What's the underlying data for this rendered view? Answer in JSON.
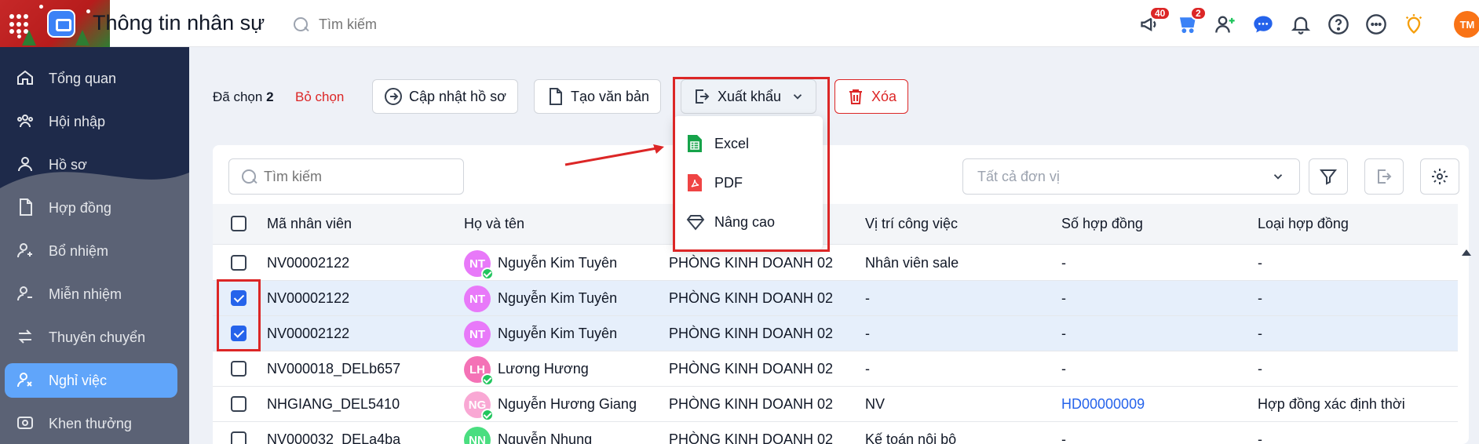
{
  "header": {
    "title": "Thông tin nhân sự",
    "search_placeholder": "Tìm kiếm",
    "badges": {
      "announce": "40",
      "cart": "2"
    },
    "avatar": "TM"
  },
  "sidebar": {
    "items": [
      {
        "label": "Tổng quan",
        "icon": "home-icon"
      },
      {
        "label": "Hội nhập",
        "icon": "group-icon"
      },
      {
        "label": "Hồ sơ",
        "icon": "user-icon"
      },
      {
        "label": "Hợp đồng",
        "icon": "document-icon"
      },
      {
        "label": "Bổ nhiệm",
        "icon": "user-plus-icon"
      },
      {
        "label": "Miễn nhiệm",
        "icon": "user-minus-icon"
      },
      {
        "label": "Thuyên chuyển",
        "icon": "transfer-icon"
      },
      {
        "label": "Nghỉ việc",
        "icon": "user-x-icon",
        "active": true
      },
      {
        "label": "Khen thưởng",
        "icon": "award-icon"
      }
    ]
  },
  "actions": {
    "selected_prefix": "Đã chọn",
    "selected_count": "2",
    "deselect": "Bỏ chọn",
    "update_profile": "Cập nhật hồ sơ",
    "create_doc": "Tạo văn bản",
    "export": "Xuất khẩu",
    "delete": "Xóa"
  },
  "export_menu": {
    "items": [
      "Excel",
      "PDF",
      "Nâng cao"
    ]
  },
  "filters": {
    "search_placeholder": "Tìm kiếm",
    "unit_select": "Tất cả đơn vị"
  },
  "table": {
    "columns": [
      "Mã nhân viên",
      "Họ và tên",
      "Vị trí công việc",
      "Số hợp đồng",
      "Loại hợp đồng"
    ],
    "rows": [
      {
        "code": "NV00002122",
        "initials": "NT",
        "name": "Nguyễn Kim Tuyên",
        "dept": "PHÒNG KINH DOANH 02",
        "position": "Nhân viên sale",
        "contract_no": "-",
        "contract_type": "-",
        "checked": false,
        "color": "#e879f9"
      },
      {
        "code": "NV00002122",
        "initials": "NT",
        "name": "Nguyễn Kim Tuyên",
        "dept": "PHÒNG KINH DOANH 02",
        "position": "-",
        "contract_no": "-",
        "contract_type": "-",
        "checked": true,
        "color": "#e879f9"
      },
      {
        "code": "NV00002122",
        "initials": "NT",
        "name": "Nguyễn Kim Tuyên",
        "dept": "PHÒNG KINH DOANH 02",
        "position": "-",
        "contract_no": "-",
        "contract_type": "-",
        "checked": true,
        "color": "#e879f9"
      },
      {
        "code": "NV000018_DELb657",
        "initials": "LH",
        "name": "Lương Hương",
        "dept": "PHÒNG KINH DOANH 02",
        "position": "-",
        "contract_no": "-",
        "contract_type": "-",
        "checked": false,
        "color": "#f472b6"
      },
      {
        "code": "NHGIANG_DEL5410",
        "initials": "NG",
        "name": "Nguyễn Hương Giang",
        "dept": "PHÒNG KINH DOANH 02",
        "position": "NV",
        "contract_no": "HD00000009",
        "contract_type": "Hợp đồng xác định thời",
        "checked": false,
        "color": "#f9a8d4"
      },
      {
        "code": "NV000032_DELa4ba",
        "initials": "NN",
        "name": "Nguyễn Nhung",
        "dept": "PHÒNG KINH DOANH 02",
        "position": "Kế toán nội bộ",
        "contract_no": "-",
        "contract_type": "-",
        "checked": false,
        "color": "#4ade80"
      }
    ]
  }
}
